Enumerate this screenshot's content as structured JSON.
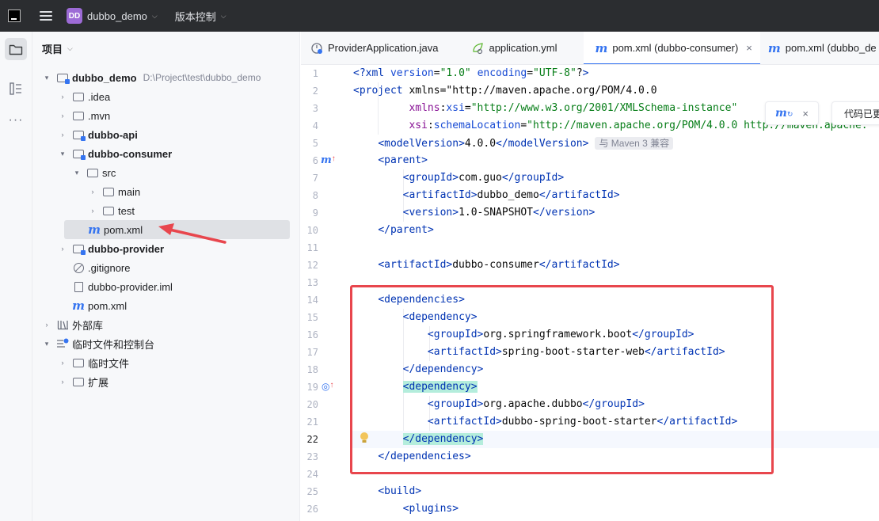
{
  "titlebar": {
    "project_badge": "DD",
    "project_name": "dubbo_demo",
    "vcs_label": "版本控制"
  },
  "project_panel": {
    "title": "项目",
    "root_path": "D:\\Project\\test\\dubbo_demo",
    "items": [
      {
        "label": "dubbo_demo",
        "bold": true,
        "icon": "module-folder-icon",
        "expanded": true
      },
      {
        "label": ".idea",
        "icon": "folder-icon"
      },
      {
        "label": ".mvn",
        "icon": "folder-icon"
      },
      {
        "label": "dubbo-api",
        "bold": true,
        "icon": "module-folder-icon"
      },
      {
        "label": "dubbo-consumer",
        "bold": true,
        "icon": "module-folder-icon",
        "expanded": true
      },
      {
        "label": "src",
        "icon": "folder-icon",
        "expanded": true
      },
      {
        "label": "main",
        "icon": "folder-icon"
      },
      {
        "label": "test",
        "icon": "folder-icon"
      },
      {
        "label": "pom.xml",
        "icon": "maven-icon",
        "selected": true
      },
      {
        "label": "dubbo-provider",
        "bold": true,
        "icon": "module-folder-icon"
      },
      {
        "label": ".gitignore",
        "icon": "ignore-file-icon"
      },
      {
        "label": "dubbo-provider.iml",
        "icon": "file-icon"
      },
      {
        "label": "pom.xml",
        "icon": "maven-icon"
      },
      {
        "label": "外部库",
        "icon": "library-icon"
      },
      {
        "label": "临时文件和控制台",
        "icon": "scratch-icon",
        "expanded": true
      },
      {
        "label": "临时文件",
        "icon": "folder-icon"
      },
      {
        "label": "扩展",
        "icon": "folder-icon"
      }
    ]
  },
  "tabs": [
    {
      "label": "ProviderApplication.java",
      "icon": "spring-boot-icon"
    },
    {
      "label": "application.yml",
      "icon": "spring-config-icon"
    },
    {
      "label": "pom.xml (dubbo-consumer)",
      "icon": "maven-icon",
      "active": true,
      "close": "×"
    },
    {
      "label": "pom.xml (dubbo_de",
      "icon": "maven-icon"
    }
  ],
  "editor": {
    "current_line": 22,
    "line_numbers": [
      "1",
      "2",
      "3",
      "4",
      "5",
      "6",
      "7",
      "8",
      "9",
      "10",
      "11",
      "12",
      "13",
      "14",
      "15",
      "16",
      "17",
      "18",
      "19",
      "20",
      "21",
      "22",
      "23",
      "24",
      "25",
      "26"
    ],
    "inlay_hint": "与 Maven 3 兼容",
    "lines": [
      "<?xml version=\"1.0\" encoding=\"UTF-8\"?>",
      "<project xmlns=\"http://maven.apache.org/POM/4.0.0\"",
      "         xmlns:xsi=\"http://www.w3.org/2001/XMLSchema-instance\"",
      "         xsi:schemaLocation=\"http://maven.apache.org/POM/4.0.0 http://maven.apache.",
      "    <modelVersion>4.0.0</modelVersion>",
      "    <parent>",
      "        <groupId>com.guo</groupId>",
      "        <artifactId>dubbo_demo</artifactId>",
      "        <version>1.0-SNAPSHOT</version>",
      "    </parent>",
      "",
      "    <artifactId>dubbo-consumer</artifactId>",
      "",
      "    <dependencies>",
      "        <dependency>",
      "            <groupId>org.springframework.boot</groupId>",
      "            <artifactId>spring-boot-starter-web</artifactId>",
      "        </dependency>",
      "        <dependency>",
      "            <groupId>org.apache.dubbo</groupId>",
      "            <artifactId>dubbo-spring-boot-starter</artifactId>",
      "        </dependency>",
      "    </dependencies>",
      "",
      "    <build>",
      "        <plugins>"
    ]
  },
  "notification": {
    "close": "×",
    "text": "代码已更"
  },
  "colors": {
    "accent": "#3574f0",
    "annotation_red": "#e8464d",
    "tag_highlight": "#b4eddc"
  }
}
